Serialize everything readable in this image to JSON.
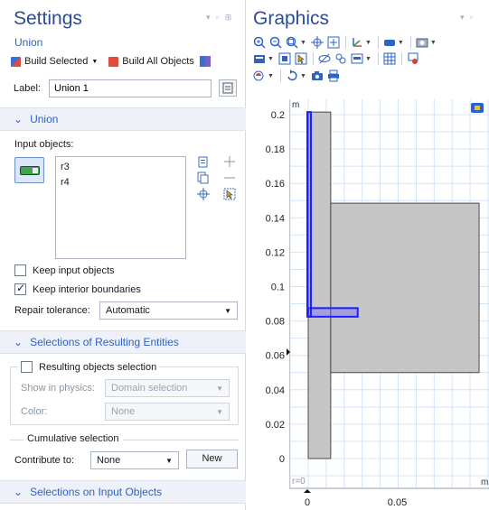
{
  "settings": {
    "title": "Settings",
    "window_controls": "▾ ▫ ⊞",
    "subtitle": "Union",
    "build_selected": "Build Selected",
    "build_all": "Build All Objects",
    "label_caption": "Label:",
    "label_value": "Union 1",
    "section_union": "Union",
    "input_objects_label": "Input objects:",
    "input_objects": [
      "r3",
      "r4"
    ],
    "keep_input_objects": "Keep input objects",
    "keep_interior_boundaries": "Keep interior boundaries",
    "repair_tolerance_label": "Repair tolerance:",
    "repair_tolerance_value": "Automatic",
    "section_selections_resulting": "Selections of Resulting Entities",
    "resulting_objects_selection": "Resulting objects selection",
    "show_in_physics_label": "Show in physics:",
    "show_in_physics_value": "Domain selection",
    "color_label": "Color:",
    "color_value": "None",
    "cumulative_selection": "Cumulative selection",
    "contribute_to_label": "Contribute to:",
    "contribute_to_value": "None",
    "new_button": "New",
    "section_selections_input": "Selections on Input Objects"
  },
  "graphics": {
    "title": "Graphics",
    "window_controls": "▾ ▫",
    "axis_unit": "m",
    "r_label": "r=0",
    "y_ticks": [
      "0.2",
      "0.18",
      "0.16",
      "0.14",
      "0.12",
      "0.1",
      "0.08",
      "0.06",
      "0.04",
      "0.02",
      "0"
    ],
    "x_ticks": [
      "0",
      "0.05"
    ]
  },
  "colors": {
    "accent_blue": "#2e62c4",
    "title_blue": "#2e4d8f",
    "selection_blue": "#1e1eff",
    "geometry_gray": "#c6c6c6",
    "grid_lines": "#d4e4f7"
  }
}
